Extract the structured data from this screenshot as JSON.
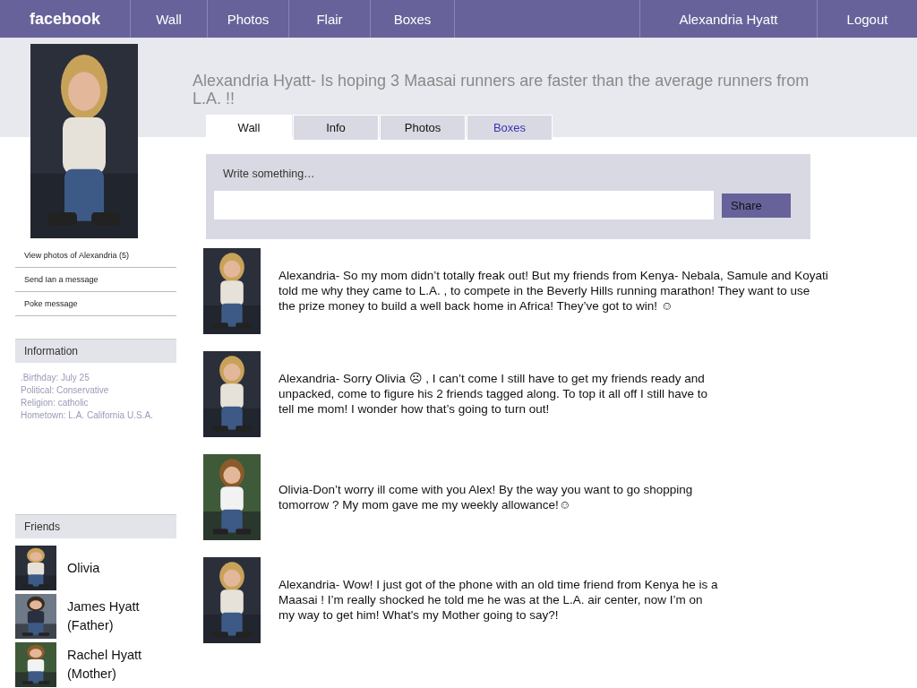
{
  "header": {
    "logo": "facebook",
    "nav": [
      "Wall",
      "Photos",
      "Flair",
      "Boxes"
    ],
    "user": "Alexandria Hyatt",
    "logout": "Logout"
  },
  "profile": {
    "status": "Alexandria Hyatt- Is hoping 3 Maasai runners are faster than the average runners from L.A. !!"
  },
  "actions": [
    "View photos of Alexandria (5)",
    "Send Ian a message",
    "Poke message"
  ],
  "information": {
    "title": "Information",
    "lines": [
      ".Birthday: July 25",
      "Political: Conservative",
      "Religion:  catholic",
      "Hometown: L.A. California  U.S.A."
    ]
  },
  "tabs": [
    {
      "label": "Wall",
      "selected": true,
      "link": false
    },
    {
      "label": "Info",
      "selected": false,
      "link": false
    },
    {
      "label": "Photos",
      "selected": false,
      "link": false
    },
    {
      "label": "Boxes",
      "selected": false,
      "link": true
    }
  ],
  "composer": {
    "prompt": "Write something…",
    "button": "Share"
  },
  "posts": [
    {
      "text": "Alexandria- So my mom didn’t totally freak out! But my friends from Kenya- Nebala, Samule and Koyati told me why they came to L.A. , to compete in the Beverly Hills running marathon!  They want to use the prize money to build a well back home in Africa! They’ve got to win! ☺"
    },
    {
      "text": "Alexandria- Sorry Olivia ☹ , I can’t come I still have to get my friends ready and unpacked, come to figure his 2 friends tagged along. To top it all off I still have to tell me mom! I wonder how that’s going to turn out!"
    },
    {
      "text": "Olivia-Don’t  worry ill come with you Alex! By the way you want to go shopping tomorrow ? My mom gave me my weekly allowance!☺"
    },
    {
      "text": "Alexandria- Wow!  I just got of the phone with an old time friend from Kenya he is a Maasai ! I’m really shocked  he told me he was at the L.A. air center, now I’m on my  way to get him! What's my Mother going to say?!"
    }
  ],
  "friends": {
    "title": "Friends",
    "items": [
      {
        "name": "Olivia"
      },
      {
        "name": "James Hyatt (Father)"
      },
      {
        "name": "Rachel Hyatt (Mother)"
      }
    ]
  }
}
